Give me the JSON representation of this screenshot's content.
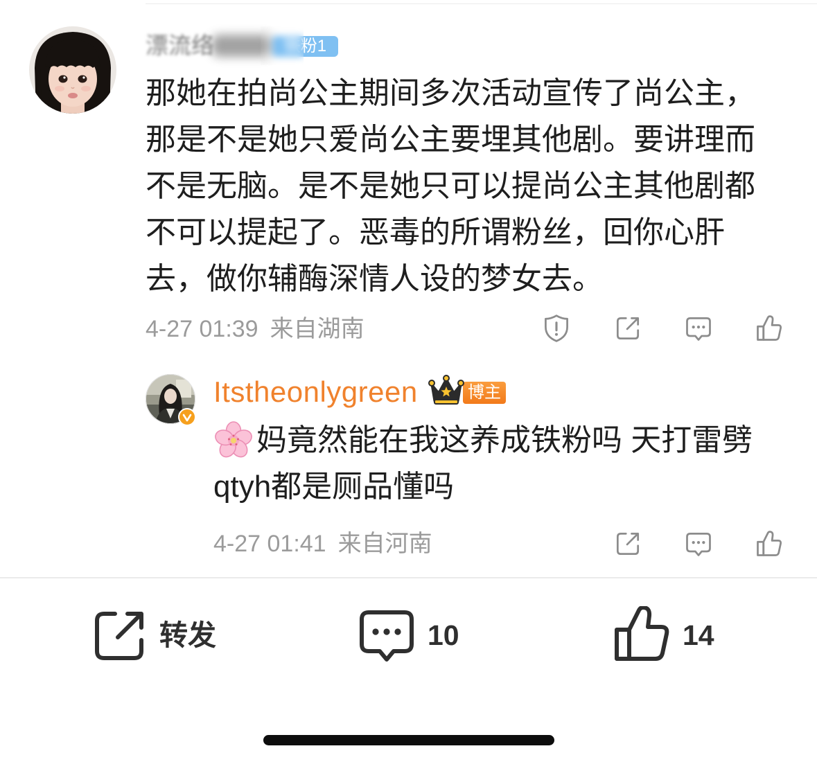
{
  "comment": {
    "avatar_icon": "child-portrait-avatar",
    "username": "漂流络",
    "fan_badge": "铁粉1",
    "text_lines": [
      "那她在拍尚公主期间多次活动宣传了尚公主，",
      "那是不是她只爱尚公主要埋其他剧。要讲理而",
      "不是无脑。是不是她只可以提尚公主其他剧都",
      "不可以提起了。恶毒的所谓粉丝，回你心肝",
      "去，做你辅酶深情人设的梦女去。"
    ],
    "time": "4-27 01:39",
    "location": "来自湖南",
    "action_icons": [
      "report-icon",
      "share-icon",
      "comment-icon",
      "like-icon"
    ]
  },
  "reply": {
    "avatar_icon": "user-photo-avatar",
    "verified_icon": "verified-v-icon",
    "username": "Itstheonlygreen",
    "crown_icon": "crown-icon",
    "role_badge": "博主",
    "emoji_icon": "cherry-blossom-icon",
    "text_lines": [
      "妈竟然能在我这养成铁粉吗 天打雷劈",
      "qtyh都是厕品懂吗"
    ],
    "time": "4-27 01:41",
    "location": "来自河南",
    "action_icons": [
      "share-icon",
      "comment-icon",
      "like-icon"
    ]
  },
  "bottom_bar": {
    "repost_icon": "share-icon",
    "repost_label": "转发",
    "comment_icon": "comment-icon",
    "comment_count": "10",
    "like_icon": "like-icon",
    "like_count": "14"
  },
  "colors": {
    "text": "#1e1e1e",
    "meta": "#9b9b9b",
    "icon": "#8c8c8c",
    "bar_text": "#2f2f2f",
    "accent_orange": "#f0822d",
    "fan_badge_blue": "#7fc0f2",
    "verified_orange": "#f6a01e",
    "divider": "#ebebeb"
  }
}
